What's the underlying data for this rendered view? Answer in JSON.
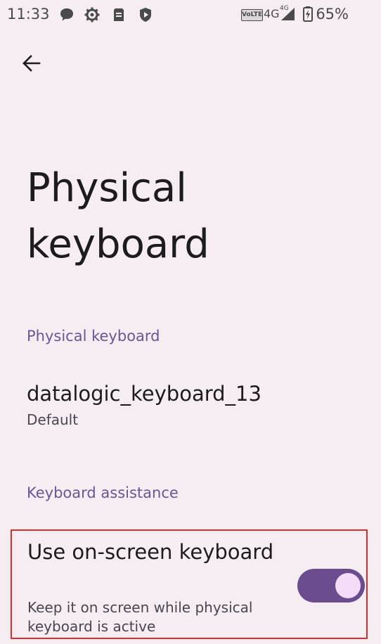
{
  "status_bar": {
    "time": "11:33",
    "volte": "VoLTE",
    "network": "4G",
    "network_small": "4G",
    "battery": "65%",
    "icons": [
      "message-icon",
      "settings-gear-icon",
      "storage-card-icon",
      "play-shield-icon"
    ]
  },
  "page": {
    "title": "Physical keyboard"
  },
  "sections": {
    "physical_keyboard_header": "Physical keyboard",
    "keyboard_assistance_header": "Keyboard assistance"
  },
  "keyboard": {
    "name": "datalogic_keyboard_13",
    "layout": "Default"
  },
  "onscreen": {
    "title": "Use on-screen keyboard",
    "summary": "Keep it on screen while physical keyboard is active",
    "enabled": true
  },
  "colors": {
    "background": "#f6edf3",
    "accent": "#6b4d8f",
    "section_header": "#6c5597",
    "highlight_border": "#d9302c"
  }
}
